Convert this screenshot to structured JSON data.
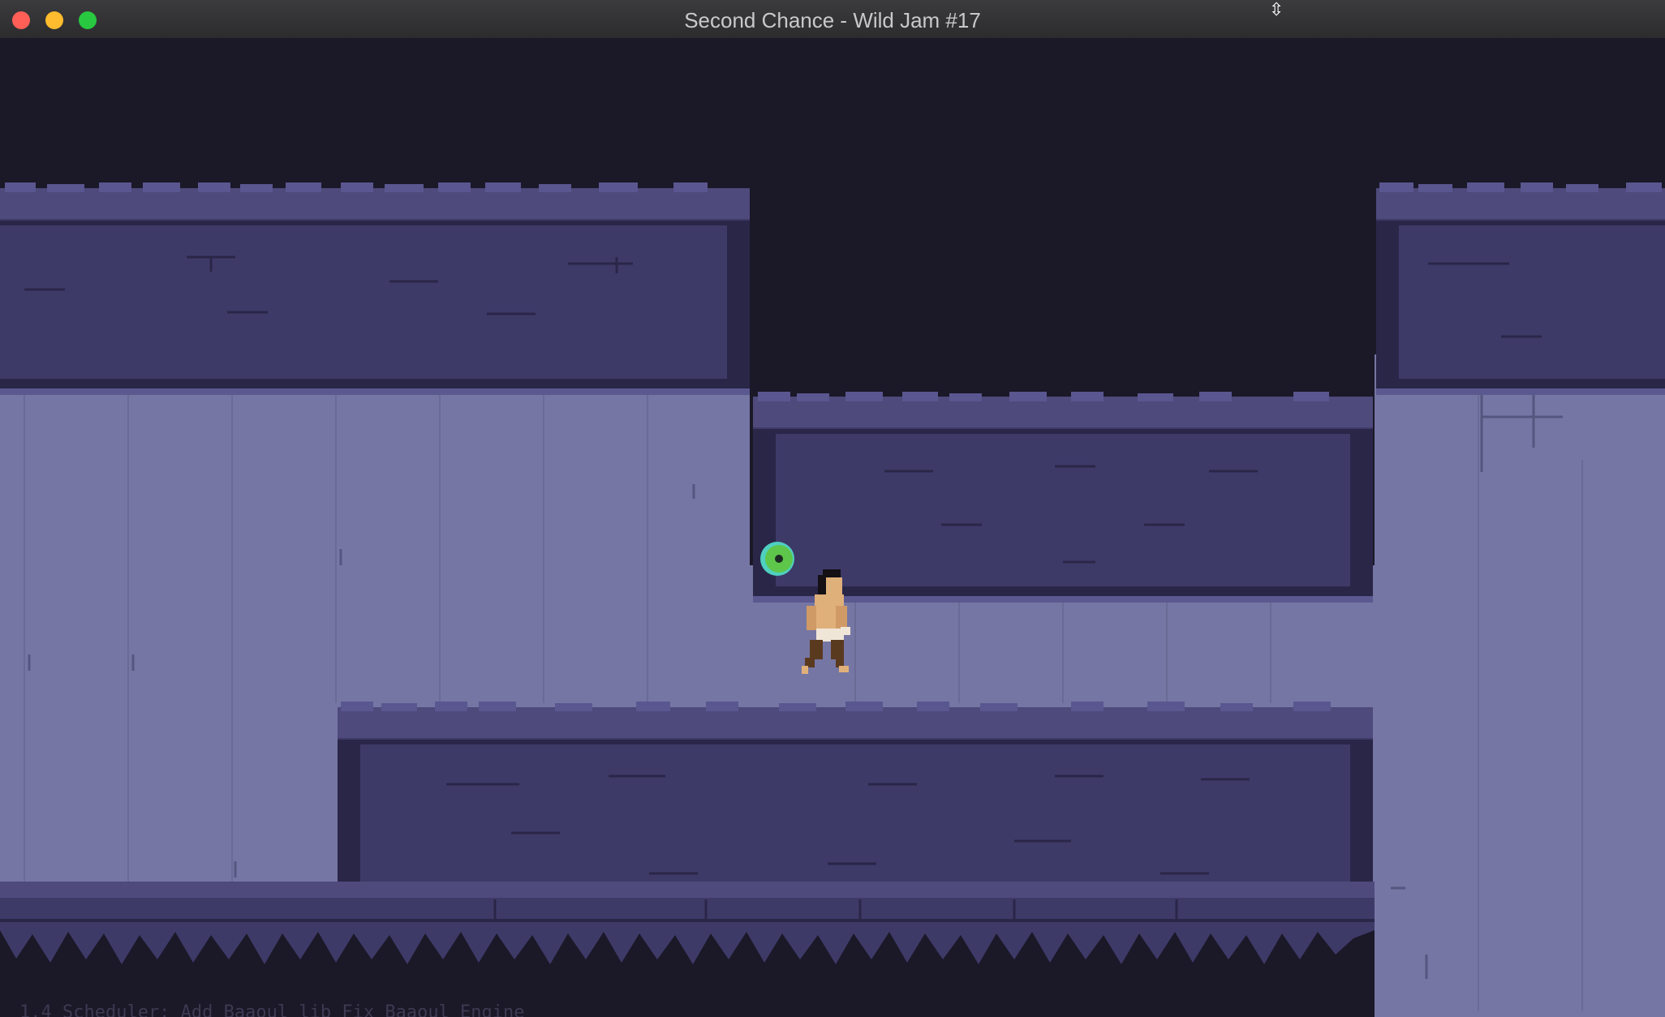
{
  "window": {
    "title": "Second Chance - Wild Jam #17",
    "controls": {
      "close": {
        "color": "#ff5f57"
      },
      "minimize": {
        "color": "#febc2e"
      },
      "maximize": {
        "color": "#28c840"
      }
    }
  },
  "game": {
    "colors": {
      "sky": "#1b1828",
      "wall": "#7676a4",
      "wall_line": "#6a6a96",
      "block": "#3e3a68",
      "block_top": "#4e4a7c",
      "block_dark": "#2a2648",
      "checkpoint_ring": "#4fd0c0",
      "checkpoint_core": "#5ec64a",
      "player_skin": "#e0b07a",
      "player_hair": "#141014",
      "player_pants": "#5a3a1e"
    },
    "icons": [
      "player-character-sprite",
      "checkpoint-orb-icon"
    ]
  },
  "footer": {
    "text": "1.4 Scheduler: Add Baaoul lib  Fix Baaoul Engine"
  }
}
